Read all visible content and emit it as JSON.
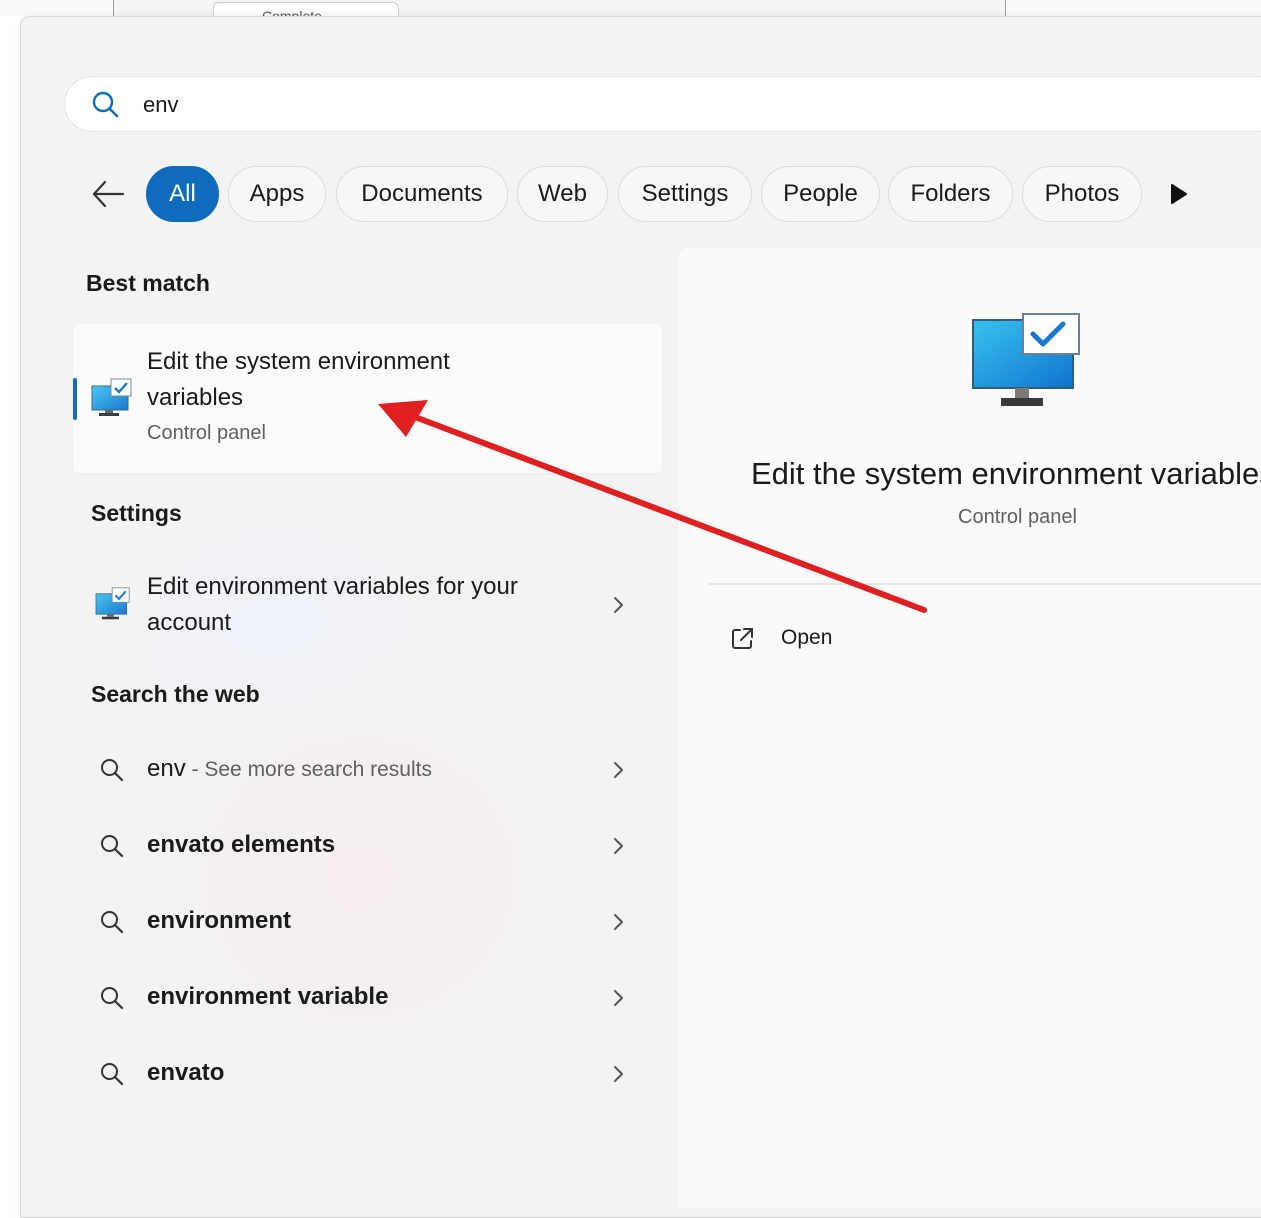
{
  "background_window": {
    "tab_label": "Complete"
  },
  "search": {
    "value": "env"
  },
  "filters": [
    "All",
    "Apps",
    "Documents",
    "Web",
    "Settings",
    "People",
    "Folders",
    "Photos"
  ],
  "sections": {
    "best_match": "Best match",
    "settings": "Settings",
    "search_web": "Search the web"
  },
  "best_match": {
    "title": "Edit the system environment variables",
    "subtitle": "Control panel"
  },
  "settings_items": [
    {
      "label": "Edit environment variables for your account"
    }
  ],
  "web_items": [
    {
      "label": "env",
      "suffix": " - See more search results"
    },
    {
      "label": "envato elements"
    },
    {
      "label": "environment"
    },
    {
      "label": "environment variable"
    },
    {
      "label": "envato"
    }
  ],
  "detail": {
    "title": "Edit the system environment variables",
    "subtitle": "Control panel",
    "actions": [
      {
        "label": "Open"
      }
    ]
  },
  "colors": {
    "accent": "#0f6cbd",
    "annotation_arrow": "#e02020"
  }
}
